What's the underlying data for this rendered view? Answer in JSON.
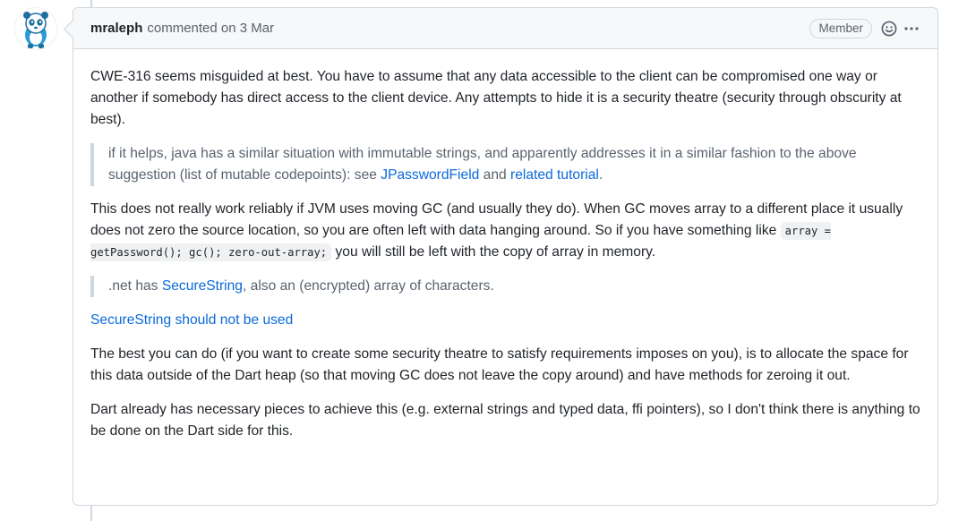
{
  "comment": {
    "author": "mraleph",
    "action": "commented on",
    "date": "3 Mar",
    "role_badge": "Member",
    "emoji_icon": "smiley-icon",
    "menu_icon": "kebab-horizontal-icon",
    "body": {
      "p1": "CWE-316 seems misguided at best. You have to assume that any data accessible to the client can be compromised one way or another if somebody has direct access to the client device. Any attempts to hide it is a security theatre (security through obscurity at best).",
      "quote1": {
        "text_before": "if it helps, java has a similar situation with immutable strings, and apparently addresses it in a similar fashion to the above suggestion (list of mutable codepoints): see",
        "link1": "JPasswordField",
        "text_mid": "and",
        "link2": "related tutorial",
        "text_end": "."
      },
      "p2": {
        "text": "This does not really work reliably if JVM uses moving GC (and usually they do). When GC moves array to a different place it usually does not zero the source location, so you are often left with data hanging around. So if you have something like",
        "code": "array = getPassword(); gc(); zero-out-array;",
        "text_after": "you will still be left with the copy of array in memory."
      },
      "quote2": {
        "text_before": ".net has",
        "link": "SecureString",
        "text_after": ", also an (encrypted) array of characters."
      },
      "link_line": "SecureString should not be used",
      "p3": "The best you can do (if you want to create some security theatre to satisfy requirements imposes on you), is to allocate the space for this data outside of the Dart heap (so that moving GC does not leave the copy around) and have methods for zeroing it out.",
      "p4": "Dart already has necessary pieces to achieve this (e.g. external strings and typed data, ffi pointers), so I don't think there is anything to be done on the Dart side for this."
    }
  },
  "colors": {
    "link": "#0969da",
    "border": "#d0d7de",
    "header_bg": "#f6f8fa",
    "text": "#1f2328",
    "muted": "#59636e",
    "avatar_accent": "#2a9bd7"
  }
}
